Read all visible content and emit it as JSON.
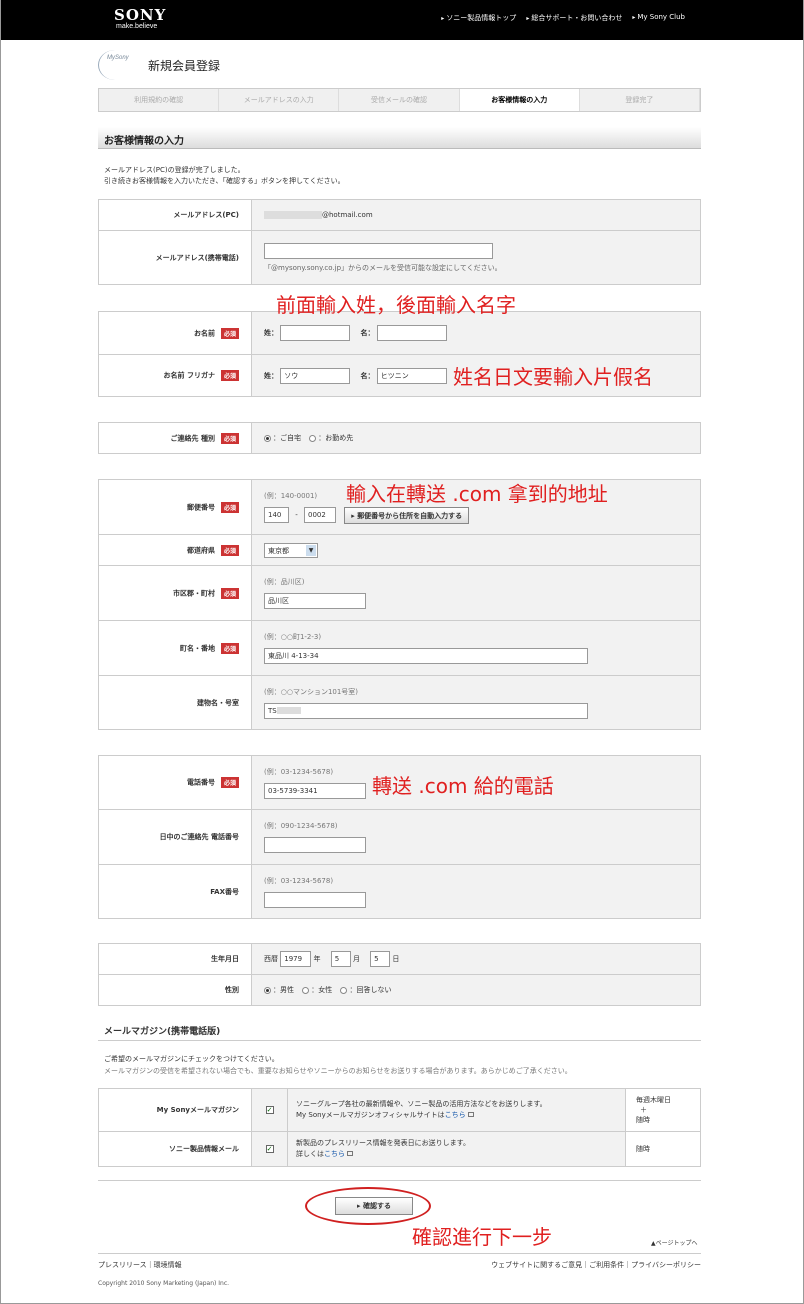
{
  "header": {
    "logo": "SONY",
    "slogan": "make.believe",
    "nav": [
      "ソニー製品情報トップ",
      "総合サポート・お問い合わせ",
      "My Sony Club"
    ]
  },
  "brand": {
    "mysony_logo": "MySony",
    "page_title": "新規会員登録"
  },
  "steps": [
    {
      "label": "利用規約の確認",
      "active": false
    },
    {
      "label": "メールアドレスの入力",
      "active": false
    },
    {
      "label": "受信メールの確認",
      "active": false
    },
    {
      "label": "お客様情報の入力",
      "active": true
    },
    {
      "label": "登録完了",
      "active": false
    }
  ],
  "section_title": "お客様情報の入力",
  "intro": {
    "line1": "メールアドレス(PC)の登録が完了しました。",
    "line2": "引き続きお客様情報を入力いただき、「確認する」ボタンを押してください。"
  },
  "required_badge": "必須",
  "email": {
    "pc_label": "メールアドレス(PC)",
    "pc_value": "@hotmail.com",
    "mobile_label": "メールアドレス(携帯電話)",
    "mobile_value": "",
    "mobile_note": "「@mysony.sony.co.jp」からのメールを受信可能な設定にしてください。"
  },
  "name": {
    "label": "お名前",
    "sei_label": "姓：",
    "mei_label": "名：",
    "sei_value": "",
    "mei_value": "",
    "kana_label": "お名前 フリガナ",
    "kana_sei_value": "ソウ",
    "kana_mei_value": "ヒツニン"
  },
  "contact": {
    "label": "ご連絡先 種別",
    "home": "：ご自宅",
    "work": "：お勤め先"
  },
  "address": {
    "zip_label": "郵便番号",
    "zip_hint": "(例：140-0001)",
    "zip1": "140",
    "zip_sep": "-",
    "zip2": "0002",
    "zip_button": "郵便番号から住所を自動入力する",
    "pref_label": "都道府県",
    "pref_value": "東京都",
    "city_label": "市区郡・町村",
    "city_hint": "(例：品川区)",
    "city_value": "品川区",
    "street_label": "町名・番地",
    "street_hint": "(例：○○町1-2-3)",
    "street_value": "東品川 4-13-34",
    "building_label": "建物名・号室",
    "building_hint": "(例：○○マンション101号室)",
    "building_value": "TS"
  },
  "phone": {
    "tel_label": "電話番号",
    "tel_hint": "(例：03-1234-5678)",
    "tel_value": "03-5739-3341",
    "day_label": "日中のご連絡先 電話番号",
    "day_hint": "(例：090-1234-5678)",
    "day_value": "",
    "fax_label": "FAX番号",
    "fax_hint": "(例：03-1234-5678)",
    "fax_value": ""
  },
  "birth": {
    "label": "生年月日",
    "era": "西暦",
    "year": "1979",
    "year_unit": "年",
    "month": "5",
    "month_unit": "月",
    "day": "5",
    "day_unit": "日"
  },
  "gender": {
    "label": "性別",
    "male": "：男性",
    "female": "：女性",
    "none": "：回答しない"
  },
  "magazine": {
    "title": "メールマガジン(携帯電話版)",
    "intro1": "ご希望のメールマガジンにチェックをつけてください。",
    "intro2": "メールマガジンの受信を希望されない場合でも、重要なお知らせやソニーからのお知らせをお送りする場合があります。あらかじめご了承ください。",
    "items": [
      {
        "label": "My Sonyメールマガジン",
        "desc1": "ソニーグループ各社の最新情報や、ソニー製品の活用方法などをお送りします。",
        "desc2": "My Sonyメールマガジンオフィシャルサイトは",
        "link": "こちら",
        "freq1": "毎週木曜日",
        "freq2": "＋",
        "freq3": "随時"
      },
      {
        "label": "ソニー製品情報メール",
        "desc1": "新製品のプレスリリース情報を発表日にお送りします。",
        "desc2": "詳しくは",
        "link": "こちら",
        "freq1": "随時"
      }
    ]
  },
  "confirm_button": "確認する",
  "page_top": "ページトップへ",
  "footer": {
    "left": "プレスリリース｜環境情報",
    "right": "ウェブサイトに関するご意見｜ご利用条件｜プライバシーポリシー",
    "copyright": "Copyright 2010 Sony Marketing (Japan) Inc."
  },
  "annotations": {
    "name_hint": "前面輸入姓，後面輸入名字",
    "kana_hint": "姓名日文要輸入片假名",
    "address_hint": "輸入在轉送 .com 拿到的地址",
    "phone_hint": "轉送 .com 給的電話",
    "next_hint": "確認進行下一步",
    "accent_color": "#e02020"
  }
}
